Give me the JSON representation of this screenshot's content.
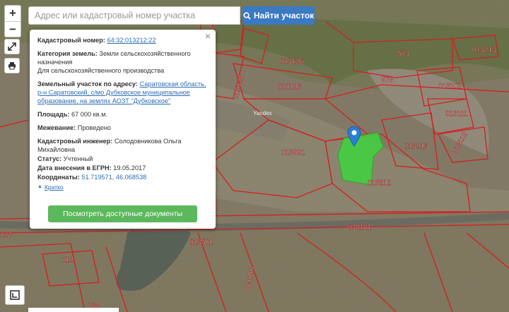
{
  "search": {
    "placeholder": "Адрес или кадастровый номер участка",
    "button_label": "Найти участок"
  },
  "controls": {
    "zoom_in": "+",
    "zoom_out": "−"
  },
  "popup": {
    "close_symbol": "×",
    "cadastral_number_label": "Кадастровый номер:",
    "cadastral_number_value": "64:32:013212:22",
    "land_category_label": "Категория земель:",
    "land_category_value": "Земли сельскохозяйственного назначения",
    "land_category_purpose": "Для сельскохозяйственного производства",
    "address_label": "Земельный участок по адресу:",
    "address_value": "Саратовская область, р-н Саратовский, с/мо Дубковское муниципальное образование, на землях АОЗТ \"Дубковское\"",
    "area_label": "Площадь:",
    "area_value": "67 000 кв.м.",
    "survey_label": "Межевание:",
    "survey_value": "Проведено",
    "engineer_label": "Кадастровый инженер:",
    "engineer_value": "Солодовникова Ольга Михайловна",
    "status_label": "Статус:",
    "status_value": "Учтенный",
    "egrn_date_label": "Дата внесения в ЕГРН:",
    "egrn_date_value": "19.05.2017",
    "coords_label": "Координаты:",
    "coords_value": "51.719571, 46.068538",
    "collapse_label": "Кратко",
    "docs_button_label": "Посмотреть доступные документы"
  },
  "map_labels": {
    "l1": "013126",
    "l2": "010126",
    "l3": "010128",
    "l4": "573",
    "l5": "573",
    "l6": "013213",
    "l7": "013102",
    "l8": "013111",
    "l9": "013112",
    "l10": "013213",
    "l11": "013591",
    "l12": "013212",
    "l13": "030101",
    "l14": "013501",
    "l15": "030101",
    "l16": "112",
    "l17": "124",
    "l18": "184",
    "l19": "Yandex",
    "l20": "010200"
  },
  "colors": {
    "parcel_border": "#d42020",
    "highlight": "#3ed43e",
    "button_blue": "#3a79c4",
    "button_green": "#5cb85c"
  }
}
